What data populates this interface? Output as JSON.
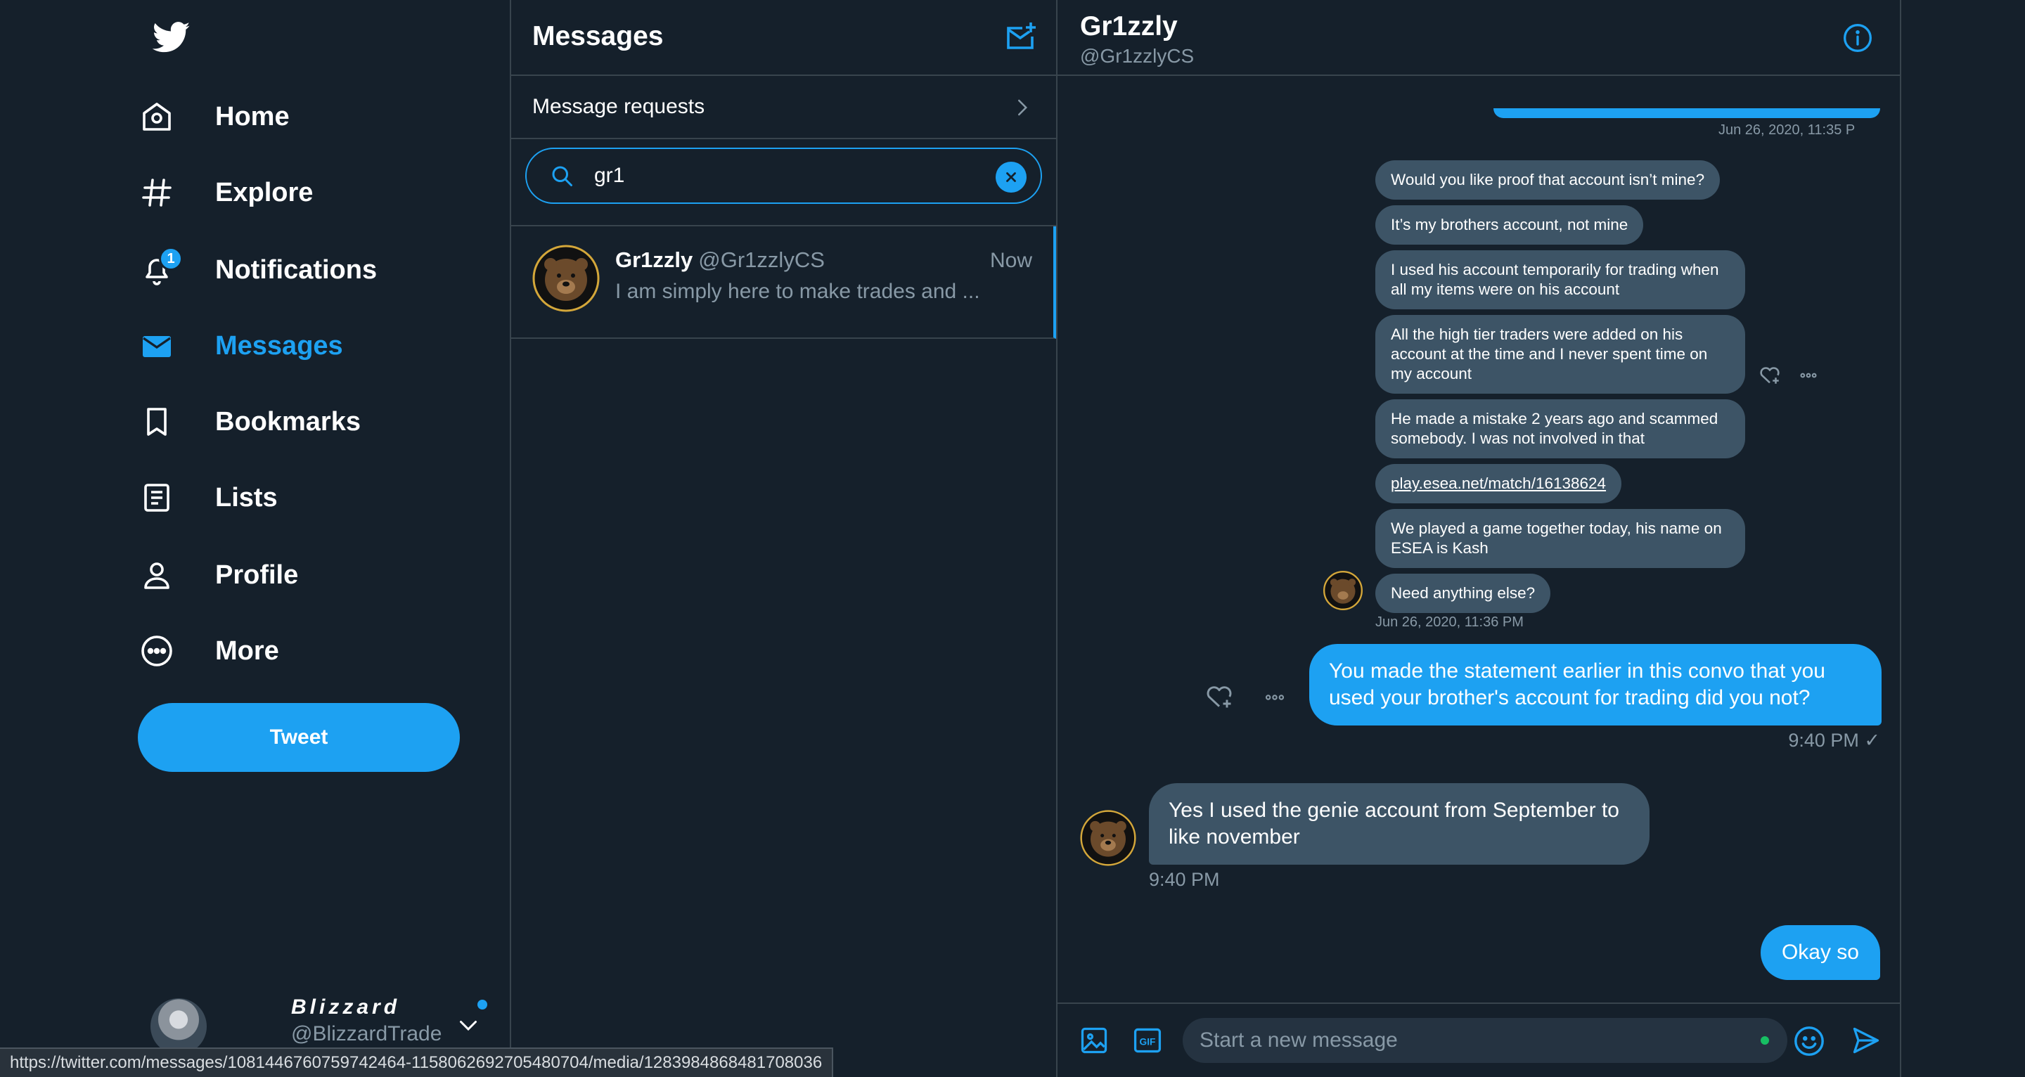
{
  "nav": {
    "items": [
      {
        "label": "Home",
        "icon": "home-icon"
      },
      {
        "label": "Explore",
        "icon": "hashtag-icon"
      },
      {
        "label": "Notifications",
        "icon": "bell-icon",
        "badge": "1"
      },
      {
        "label": "Messages",
        "icon": "envelope-icon",
        "active": true
      },
      {
        "label": "Bookmarks",
        "icon": "bookmark-icon"
      },
      {
        "label": "Lists",
        "icon": "list-icon"
      },
      {
        "label": "Profile",
        "icon": "person-icon"
      },
      {
        "label": "More",
        "icon": "more-circle-icon"
      }
    ],
    "tweet_label": "Tweet",
    "account": {
      "display_name": "Blizzard",
      "handle": "@BlizzardTrade"
    }
  },
  "messages": {
    "title": "Messages",
    "requests_label": "Message requests",
    "search_value": "gr1",
    "conversation": {
      "name": "Gr1zzly",
      "handle": "@Gr1zzlyCS",
      "time": "Now",
      "preview": "I am simply here to make trades and ..."
    }
  },
  "chat": {
    "name": "Gr1zzly",
    "handle": "@Gr1zzlyCS",
    "top_timestamp": "Jun 26, 2020, 11:35 P",
    "received_group": [
      "Would you like proof that account isn’t mine?",
      "It’s my brothers account, not mine",
      "I used his account temporarily for trading when all my items were on his account",
      "All the high tier traders were added on his account at the time and I never spent time on my account",
      "He made a mistake 2 years ago and scammed somebody. I was not involved in that",
      "play.esea.net/match/16138624",
      "We played a game together today, his name on ESEA is Kash",
      "Need anything else?"
    ],
    "group_timestamp": "Jun 26, 2020, 11:36 PM",
    "sent_1": "You made the statement earlier in this convo that you used your brother's account for trading did you not?",
    "sent_1_time": "9:40 PM ✓",
    "received_2": "Yes I used the genie account from September to like november",
    "received_2_time": "9:40 PM",
    "sent_2": "Okay so",
    "composer_placeholder": "Start a new message"
  },
  "status_url": "https://twitter.com/messages/1081446760759742464-1158062692705480704/media/1283984868481708036",
  "colors": {
    "background": "#15202b",
    "accent": "#1da1f2",
    "bubble_received": "#3d5466",
    "muted": "#8899a6"
  }
}
